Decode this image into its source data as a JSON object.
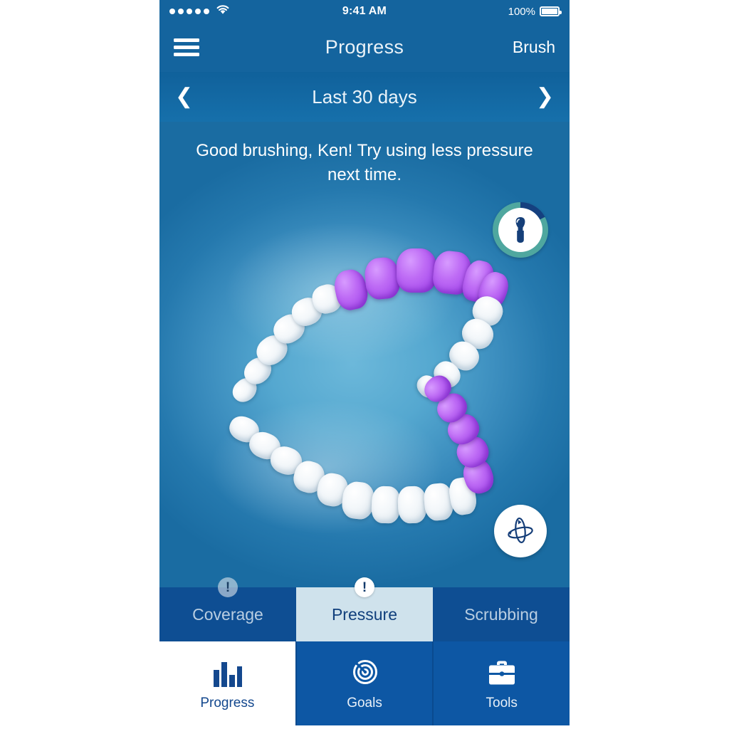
{
  "status_bar": {
    "signal_dots": 5,
    "wifi_icon": "wifi-icon",
    "time": "9:41 AM",
    "battery_percent": "100%",
    "battery_icon": "battery-full-icon"
  },
  "nav_bar": {
    "menu_icon": "hamburger-menu-icon",
    "title": "Progress",
    "action_label": "Brush"
  },
  "date_selector": {
    "prev_icon": "chevron-left-icon",
    "label": "Last 30 days",
    "next_icon": "chevron-right-icon"
  },
  "main": {
    "coach_message": "Good brushing, Ken! Try using less pressure next time.",
    "brush_badge": {
      "icon": "toothbrush-head-icon",
      "ring_accent_color": "#4FA79F",
      "ring_progress_color": "#15407F"
    },
    "rotate_button": {
      "icon": "rotate-3d-icon"
    },
    "highlight_color": "#A84FF0",
    "tooth_color": "#FFFFFF",
    "background_color": "#3B8DBE"
  },
  "metric_tabs": [
    {
      "label": "Coverage",
      "badge": "!",
      "active": false
    },
    {
      "label": "Pressure",
      "badge": "!",
      "active": true
    },
    {
      "label": "Scrubbing",
      "badge": "",
      "active": false
    }
  ],
  "bottom_nav": [
    {
      "label": "Progress",
      "icon": "bar-chart-icon",
      "active": true
    },
    {
      "label": "Goals",
      "icon": "target-dart-icon",
      "active": false
    },
    {
      "label": "Tools",
      "icon": "toolbox-icon",
      "active": false
    }
  ],
  "colors": {
    "header_blue": "#14649E",
    "tab_blue": "#0E4E93",
    "nav_blue": "#0D57A4",
    "active_tab_bg": "#CFE2EC",
    "active_tab_text": "#103F7C"
  }
}
